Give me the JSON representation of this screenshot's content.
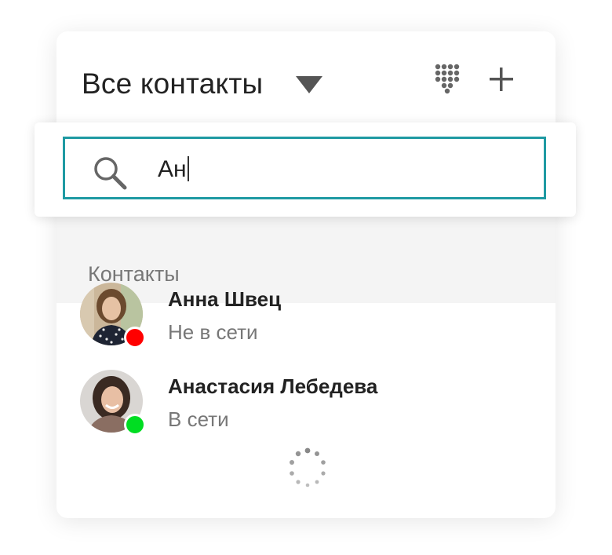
{
  "header": {
    "title": "Все контакты",
    "dropdown_icon": "caret-down-icon",
    "dialpad_icon": "dialpad-icon",
    "add_icon": "plus-icon"
  },
  "search": {
    "value": "Ан",
    "icon": "search-icon",
    "border_color": "#1f9aa3"
  },
  "section": {
    "label": "Контакты"
  },
  "contacts": [
    {
      "name": "Анна Швец",
      "status": "Не в сети",
      "status_color": "#ff0000"
    },
    {
      "name": "Анастасия Лебедева",
      "status": "В сети",
      "status_color": "#00dd22"
    }
  ],
  "loading_icon": "spinner-icon"
}
